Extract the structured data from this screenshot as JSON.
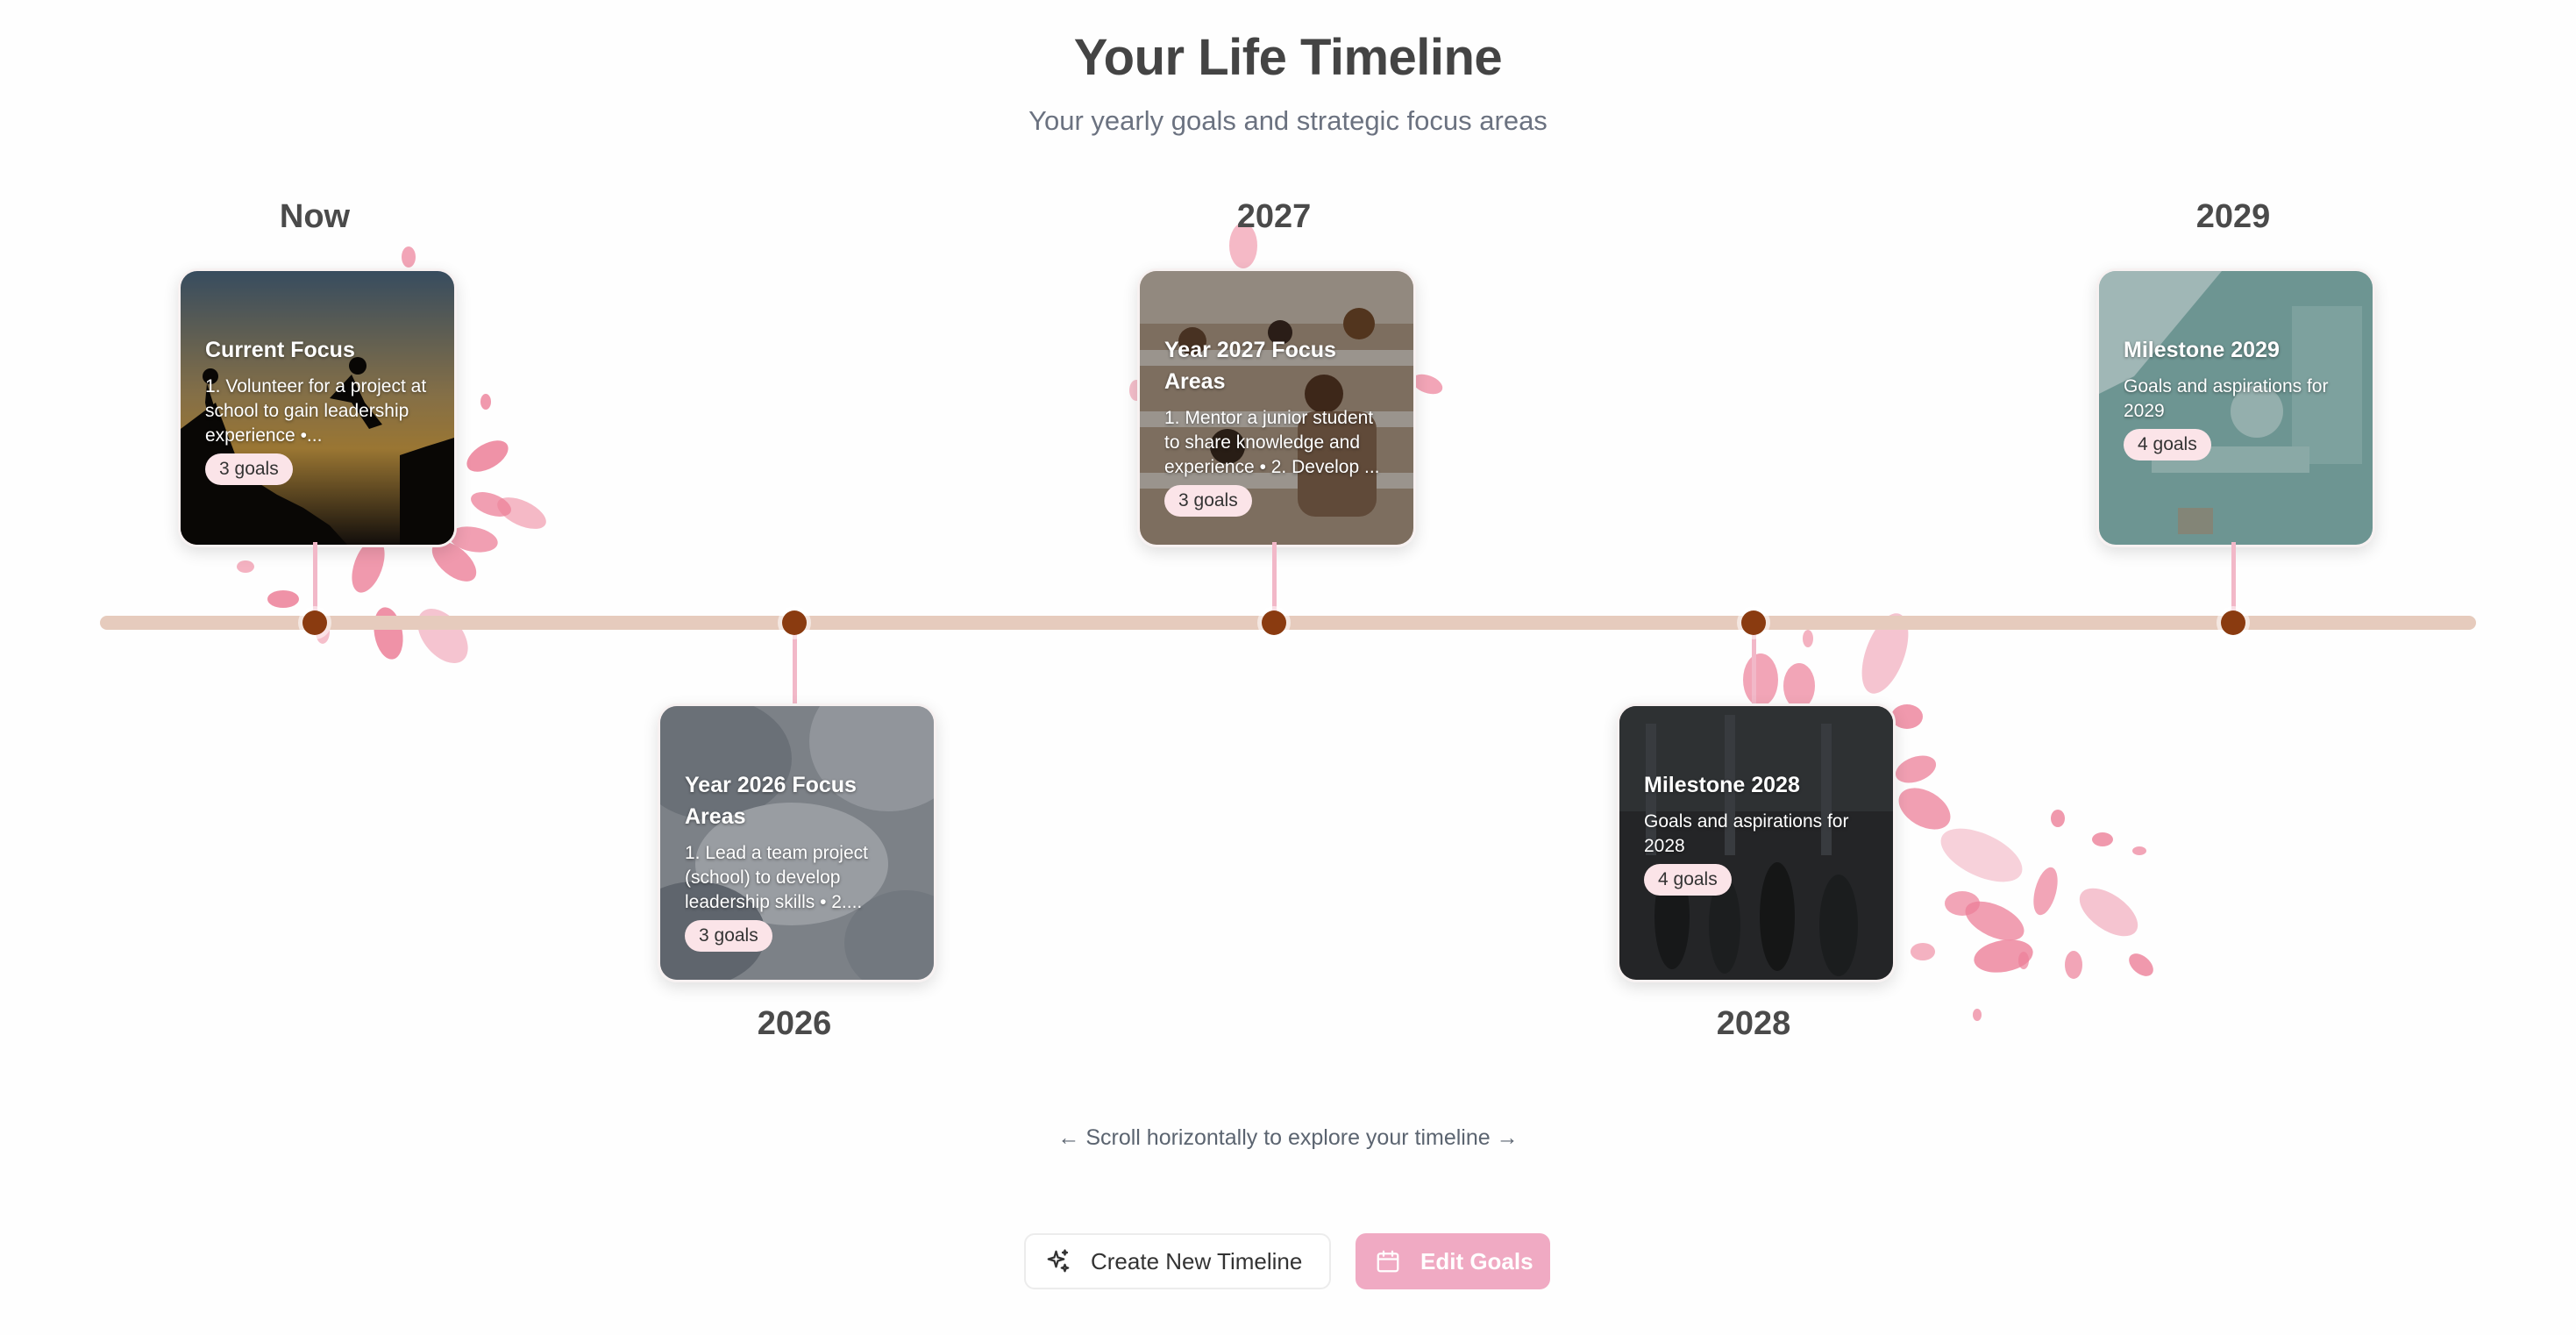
{
  "header": {
    "title": "Your Life Timeline",
    "subtitle": "Your yearly goals and strategic focus areas"
  },
  "timeline": {
    "milestones": [
      {
        "year_label": "Now",
        "card_title": "Current Focus",
        "card_description": "1. Volunteer for a project at school to gain leadership experience •...",
        "goals_badge": "3 goals",
        "image_subject": "silhouettes helping each other climb at sunset"
      },
      {
        "year_label": "2026",
        "card_title": "Year 2026 Focus Areas",
        "card_description": "1. Lead a team project (school) to develop leadership skills • 2....",
        "goals_badge": "3 goals",
        "image_subject": "team stacking hands together"
      },
      {
        "year_label": "2027",
        "card_title": "Year 2027 Focus Areas",
        "card_description": "1. Mentor a junior student to share knowledge and experience • 2. Develop ...",
        "goals_badge": "3 goals",
        "image_subject": "students in a lecture hall"
      },
      {
        "year_label": "2028",
        "card_title": "Milestone 2028",
        "card_description": "Goals and aspirations for 2028",
        "goals_badge": "4 goals",
        "image_subject": "crowd walking in a dark hall"
      },
      {
        "year_label": "2029",
        "card_title": "Milestone 2029",
        "card_description": "Goals and aspirations for 2029",
        "goals_badge": "4 goals",
        "image_subject": "bright classroom"
      }
    ]
  },
  "hint": "← Scroll horizontally to explore your timeline →",
  "actions": {
    "create_label": "Create New Timeline",
    "create_icon": "sparkles-icon",
    "edit_label": "Edit Goals",
    "edit_icon": "calendar-icon"
  },
  "colors": {
    "timeline_line": "#e6cbbd",
    "node": "#8a3b10",
    "connector": "#f2b8c8",
    "badge_bg": "#fbe4e8",
    "edit_button_bg": "#f0aac3",
    "petal": "#ec7f98"
  }
}
